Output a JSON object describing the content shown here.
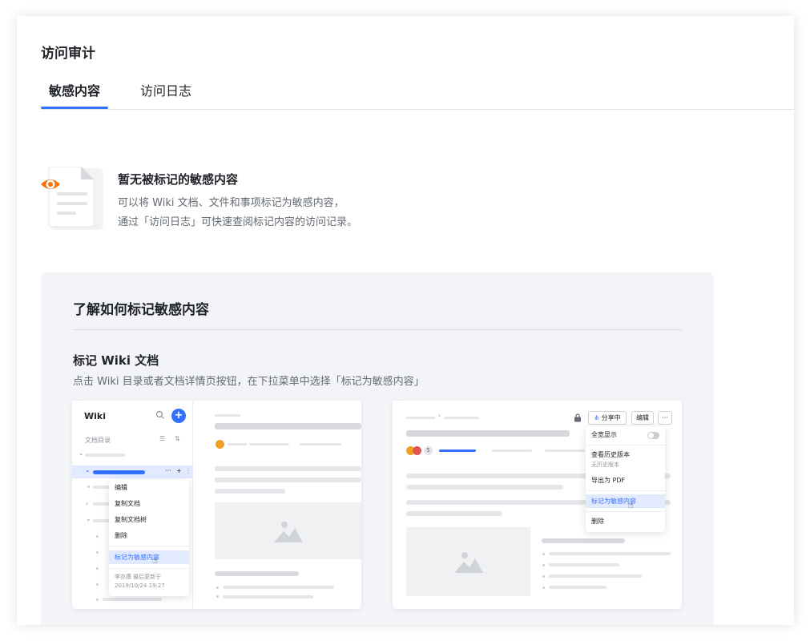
{
  "page": {
    "title": "访问审计"
  },
  "tabs": [
    {
      "label": "敏感内容",
      "active": true
    },
    {
      "label": "访问日志",
      "active": false
    }
  ],
  "empty_state": {
    "title": "暂无被标记的敏感内容",
    "desc_line1": "可以将 Wiki 文档、文件和事项标记为敏感内容，",
    "desc_line2": "通过「访问日志」可快速查阅标记内容的访问记录。"
  },
  "guide": {
    "title": "了解如何标记敏感内容",
    "subtitle": "标记 Wiki 文档",
    "desc": "点击 Wiki 目录或者文档详情页按钮，在下拉菜单中选择「标记为敏感内容」"
  },
  "left_shot": {
    "header": "Wiki",
    "dir_label": "文档目录",
    "menu": [
      "编辑",
      "复制文档",
      "复制文档树",
      "删除"
    ],
    "menu_highlight": "标记为敏感内容",
    "meta_line1": "李亦康 最后更新于",
    "meta_line2": "2019/10/24 19:27"
  },
  "right_shot": {
    "share_label": "分享中",
    "edit_label": "编辑",
    "more_label": "···",
    "avatar_count": "5",
    "menu": {
      "fullwidth": "全宽显示",
      "history": "查看历史版本",
      "history_note": "无历史版本",
      "export": "导出为 PDF",
      "mark": "标记为敏感内容",
      "delete": "删除"
    }
  },
  "colors": {
    "accent": "#3370ff",
    "eye": "#f5710a"
  }
}
